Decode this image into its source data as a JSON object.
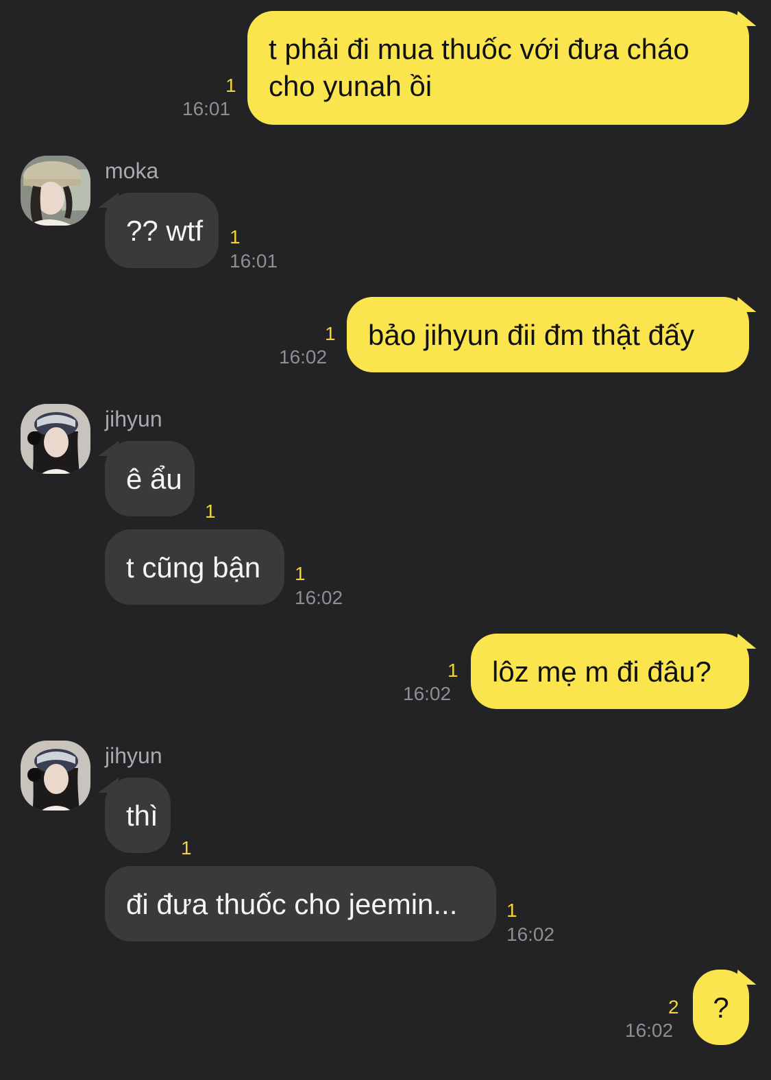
{
  "messages": [
    {
      "sender": "me",
      "text": "t phải đi mua thuốc với đưa cháo\ncho yunah ồi",
      "unread": "1",
      "time": "16:01"
    },
    {
      "sender": "moka",
      "name": "moka",
      "text": "?? wtf",
      "unread": "1",
      "time": "16:01"
    },
    {
      "sender": "me",
      "text": "bảo jihyun đii đm thật đấy",
      "unread": "1",
      "time": "16:02"
    },
    {
      "sender": "jihyun",
      "name": "jihyun",
      "text": "ê ẩu",
      "unread": "1",
      "time": ""
    },
    {
      "sender": "jihyun",
      "text": "t cũng bận",
      "unread": "1",
      "time": "16:02"
    },
    {
      "sender": "me",
      "text": "lôz mẹ m đi đâu?",
      "unread": "1",
      "time": "16:02"
    },
    {
      "sender": "jihyun",
      "name": "jihyun",
      "text": "thì",
      "unread": "1",
      "time": ""
    },
    {
      "sender": "jihyun",
      "text": "đi đưa thuốc cho jeemin...",
      "unread": "1",
      "time": "16:02"
    },
    {
      "sender": "me",
      "text": "?",
      "unread": "2",
      "time": "16:02"
    }
  ],
  "colors": {
    "background": "#232325",
    "my_bubble": "#FBE54F",
    "their_bubble": "#3A3A3C",
    "unread": "#F2D33A",
    "time": "#8E8E93"
  }
}
